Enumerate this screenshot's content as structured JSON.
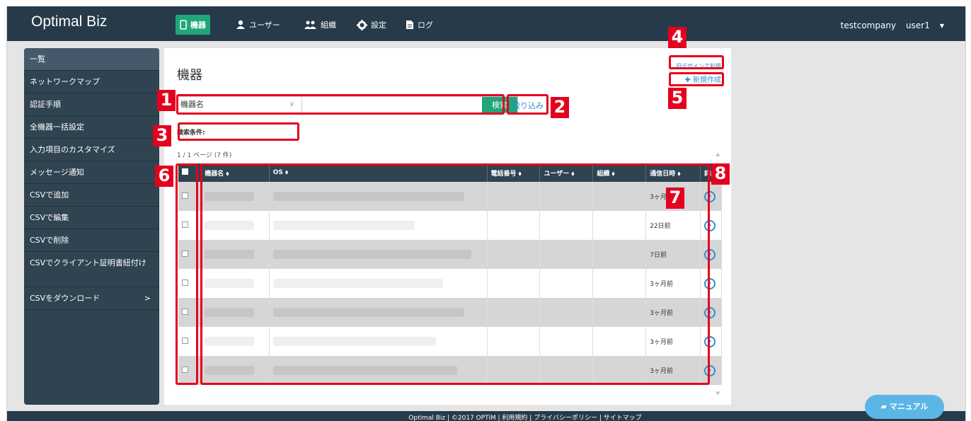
{
  "header": {
    "brand": "Optimal Biz",
    "nav": [
      {
        "label": "機器",
        "icon": "phone-icon"
      },
      {
        "label": "ユーザー",
        "icon": "user-icon"
      },
      {
        "label": "組織",
        "icon": "group-icon"
      },
      {
        "label": "設定",
        "icon": "gear-icon"
      },
      {
        "label": "ログ",
        "icon": "document-icon"
      }
    ],
    "company": "testcompany",
    "user": "user1"
  },
  "sidebar": {
    "items": [
      {
        "label": "一覧"
      },
      {
        "label": "ネットワークマップ"
      },
      {
        "label": "認証手順"
      },
      {
        "label": "全機器一括設定"
      },
      {
        "label": "入力項目のカスタマイズ"
      },
      {
        "label": "メッセージ通知"
      },
      {
        "label": "CSVで追加"
      },
      {
        "label": "CSVで編集"
      },
      {
        "label": "CSVで削除"
      },
      {
        "label": "CSVでクライアント証明書紐付け"
      },
      {
        "label": "CSVをダウンロード"
      }
    ]
  },
  "main": {
    "title": "機器",
    "old_design_link": "旧デザインで利用",
    "new_button": "新規作成",
    "search": {
      "select_value": "機器名",
      "input_value": "",
      "button": "検索"
    },
    "filter_link": "絞り込み",
    "conditions_label": "検索条件:",
    "page_info": "1 / 1 ページ (7 件)",
    "table": {
      "headers": [
        "機器名 ⬧",
        "OS ⬧",
        "電話番号 ⬧",
        "ユーザー ⬧",
        "組織 ⬧",
        "通信日時 ⬧",
        "詳細"
      ],
      "rows": [
        {
          "time": "3ヶ月前"
        },
        {
          "time": "22日前"
        },
        {
          "time": "7日前"
        },
        {
          "time": "3ヶ月前"
        },
        {
          "time": "3ヶ月前"
        },
        {
          "time": "3ヶ月前"
        },
        {
          "time": "3ヶ月前"
        }
      ]
    }
  },
  "annotations": [
    "1",
    "2",
    "3",
    "4",
    "5",
    "6",
    "7",
    "8"
  ],
  "footer": "Optimal Biz | ©2017 OPTiM | 利用規約 | プライバシーポリシー | サイトマップ",
  "manual_button": "マニュアル",
  "colors": {
    "nav": "#263a49",
    "sidebar": "#2f4351",
    "accent": "#1fa67a",
    "link": "#2c8fce",
    "annotation": "#e4001e"
  }
}
